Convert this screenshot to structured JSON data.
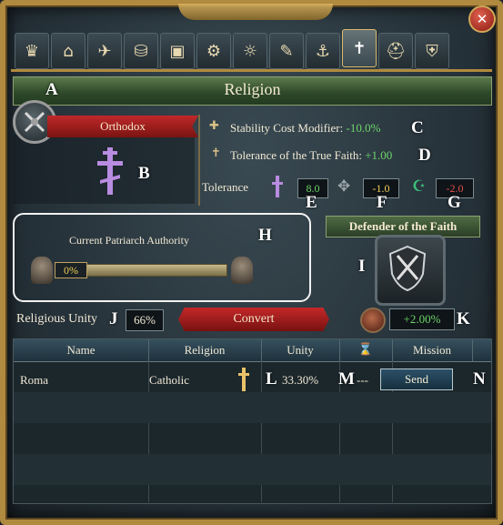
{
  "window": {
    "title": "Religion",
    "close_icon": "close-icon"
  },
  "tabs": [
    {
      "icon": "crown-icon",
      "glyph": "♛"
    },
    {
      "icon": "building-icon",
      "glyph": "🏛"
    },
    {
      "icon": "dove-icon",
      "glyph": "🕊"
    },
    {
      "icon": "coins-icon",
      "glyph": "⛁"
    },
    {
      "icon": "crate-icon",
      "glyph": "▣"
    },
    {
      "icon": "gears-icon",
      "glyph": "⚙"
    },
    {
      "icon": "lightbulb-icon",
      "glyph": "💡"
    },
    {
      "icon": "scroll-icon",
      "glyph": "📜"
    },
    {
      "icon": "ship-icon",
      "glyph": "⛵"
    },
    {
      "icon": "cross-icon",
      "glyph": "✝",
      "active": true
    },
    {
      "icon": "helmet-icon",
      "glyph": "⛑"
    },
    {
      "icon": "shield-icon",
      "glyph": "⛨"
    }
  ],
  "annotations": {
    "A": "A",
    "B": "B",
    "C": "C",
    "D": "D",
    "E": "E",
    "F": "F",
    "G": "G",
    "H": "H",
    "I": "I",
    "J": "J",
    "K": "K",
    "L": "L",
    "M": "M",
    "N": "N"
  },
  "religion": {
    "name": "Orthodox",
    "icon": "orthodox-cross-icon",
    "stability_label": "Stability Cost Modifier:",
    "stability_value": "-10.0%",
    "true_faith_label": "Tolerance of the True Faith:",
    "true_faith_value": "+1.00",
    "tolerance_label": "Tolerance",
    "tolerance_values": {
      "true_faith": "8.0",
      "heretic": "-1.0",
      "heathen": "-2.0"
    }
  },
  "patriarch": {
    "label": "Current Patriarch Authority",
    "value": "0%",
    "fill_fraction": 0.0
  },
  "defender": {
    "label": "Defender of the Faith"
  },
  "unity": {
    "label": "Religious Unity",
    "value": "66%"
  },
  "convert": {
    "label": "Convert"
  },
  "mission": {
    "strength": "+2.00%"
  },
  "table": {
    "headers": [
      "Name",
      "Religion",
      "Unity",
      "⌛",
      "Mission"
    ],
    "rows": [
      {
        "name": "Roma",
        "religion": "Catholic",
        "unity": "33.30%",
        "time": "---",
        "action": "Send"
      }
    ]
  },
  "colors": {
    "frame_gold": "#b08a3e",
    "positive_green": "#6ed46a",
    "negative_red": "#e85050",
    "ribbon_red": "#c0282a",
    "banner_green": "#4f6b45"
  }
}
